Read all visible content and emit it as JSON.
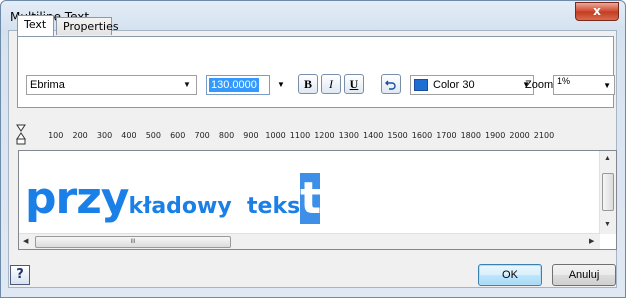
{
  "window": {
    "title": "Multiline Text",
    "close_glyph": "x"
  },
  "tabs": [
    {
      "label": "Text"
    },
    {
      "label": "Properties"
    }
  ],
  "toolbar": {
    "font": "Ebrima",
    "size": "130.0000",
    "bold_label": "B",
    "italic_label": "I",
    "underline_label": "U",
    "undo_icon": "undo-icon",
    "color_label": "Color 30",
    "color_hex": "#1e6fd1",
    "zoom_label": "Zoom",
    "zoom_value": "1%"
  },
  "ruler": {
    "ticks": [
      "100",
      "200",
      "300",
      "400",
      "500",
      "600",
      "700",
      "800",
      "900",
      "1000",
      "1100",
      "1200",
      "1300",
      "1400",
      "1500",
      "1600",
      "1700",
      "1800",
      "1900",
      "2000",
      "2100"
    ]
  },
  "editor": {
    "text_large_1": "przy",
    "text_small_1": "k",
    "text_large_2": "ł",
    "text_small_2": "adowy  teks",
    "text_selected": "t",
    "text_color": "#1a7fe6"
  },
  "scroll": {
    "thumb_grip": "III"
  },
  "buttons": {
    "help": "?",
    "ok": "OK",
    "cancel": "Anuluj"
  }
}
